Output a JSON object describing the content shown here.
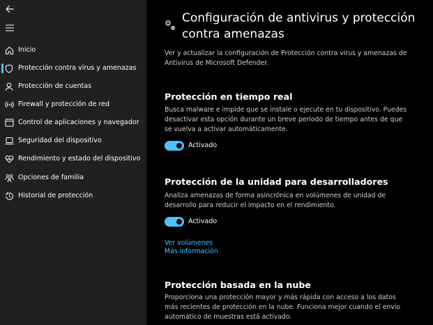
{
  "sidebar": {
    "items": [
      {
        "label": "Inicio",
        "icon": "home-icon",
        "selected": false
      },
      {
        "label": "Protección contra virus y amenazas",
        "icon": "shield-icon",
        "selected": true
      },
      {
        "label": "Protección de cuentas",
        "icon": "person-icon",
        "selected": false
      },
      {
        "label": "Firewall y protección de red",
        "icon": "wifi-signal-icon",
        "selected": false
      },
      {
        "label": "Control de aplicaciones y navegador",
        "icon": "app-window-icon",
        "selected": false
      },
      {
        "label": "Seguridad del dispositivo",
        "icon": "laptop-icon",
        "selected": false
      },
      {
        "label": "Rendimiento y estado del dispositivo",
        "icon": "heart-pulse-icon",
        "selected": false
      },
      {
        "label": "Opciones de familia",
        "icon": "family-icon",
        "selected": false
      },
      {
        "label": "Historial de protección",
        "icon": "history-icon",
        "selected": false
      }
    ]
  },
  "main": {
    "title": "Configuración de antivirus y protección contra amenazas",
    "description": "Ver y actualizar la configuración de Protección contra virus y amenazas de Antivirus de Microsoft Defender.",
    "sections": [
      {
        "title": "Protección en tiempo real",
        "description": "Busca malware e impide que se instale o ejecute en tu dispositivo. Puedes desactivar esta opción durante un breve período de tiempo antes de que se vuelva a activar automáticamente.",
        "toggle_label": "Activado",
        "toggle_on": true
      },
      {
        "title": "Protección de la unidad para desarrolladores",
        "description": "Analiza amenazas de forma asincrónica en volúmenes de unidad de desarrollo para reducir el impacto en el rendimiento.",
        "toggle_label": "Activado",
        "toggle_on": true,
        "links": [
          "Ver volúmenes",
          "Más información"
        ]
      },
      {
        "title": "Protección basada en la nube",
        "description": "Proporciona una protección mayor y más rápida con acceso a los datos más recientes de protección en la nube. Funciona mejor cuando el envío automático de muestras está activado."
      }
    ]
  },
  "colors": {
    "accent": "#4cc2ff",
    "sidebar_bg": "#202020",
    "main_bg": "#000000"
  }
}
